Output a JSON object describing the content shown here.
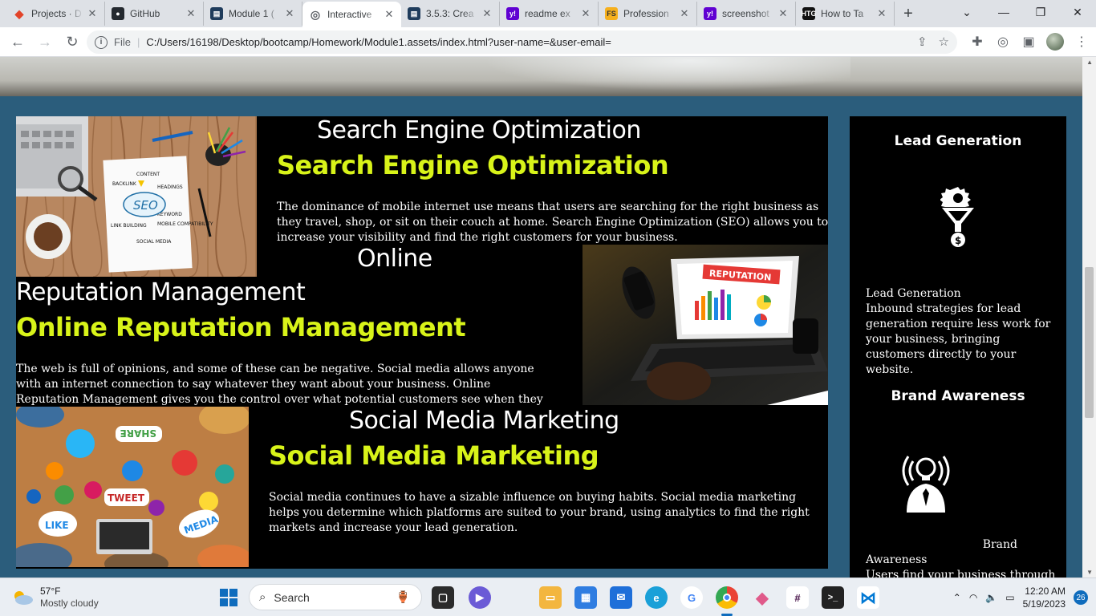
{
  "browser": {
    "tabs": [
      {
        "label": "Projects · D",
        "icon": "gitlab-icon",
        "color": "#e24329"
      },
      {
        "label": "GitHub",
        "icon": "github-icon",
        "color": "#24292f"
      },
      {
        "label": "Module 1 (",
        "icon": "canvas-icon",
        "color": "#1f3c5c"
      },
      {
        "label": "Interactive",
        "icon": "globe-icon",
        "color": "#5f6368",
        "active": true
      },
      {
        "label": "3.5.3: Crea",
        "icon": "canvas-icon",
        "color": "#1f3c5c"
      },
      {
        "label": "readme ex",
        "icon": "yahoo-icon",
        "color": "#6001d2"
      },
      {
        "label": "Profession",
        "icon": "fs-icon",
        "color": "#f6b01e"
      },
      {
        "label": "screenshot",
        "icon": "yahoo-icon",
        "color": "#6001d2"
      },
      {
        "label": "How to Ta",
        "icon": "htg-icon",
        "color": "#111111"
      }
    ],
    "new_tab": "+",
    "address": {
      "scheme": "File",
      "url": "C:/Users/16198/Desktop/bootcamp/Homework/Module1.assets/index.html?user-name=&user-email="
    }
  },
  "page": {
    "services": [
      {
        "title": "Search Engine Optimization",
        "subtitle": "Search Engine Optimization",
        "body": "The dominance of mobile internet use means that users are searching for the right business as they travel, shop, or sit on their couch at home. Search Engine Optimization (SEO) allows you to increase your visibility and find the right customers for your business."
      },
      {
        "title_line1": "Online",
        "title_line2": "Reputation Management",
        "subtitle": "Online Reputation Management",
        "body": "The web is full of opinions, and some of these can be negative. Social media allows anyone with an internet connection to say whatever they want about your business. Online Reputation Management gives you the control over what potential customers see when they search for your business."
      },
      {
        "title": "Social Media Marketing",
        "subtitle": "Social Media Marketing",
        "body": "Social media continues to have a sizable influence on buying habits. Social media marketing helps you determine which platforms are suited to your brand, using analytics to find the right markets and increase your lead generation."
      }
    ],
    "seo_image_labels": {
      "seo": "SEO",
      "content": "CONTENT",
      "backlink": "BACKLINK",
      "headings": "HEADINGS",
      "keyword": "KEYWORD",
      "link_building": "LINK BUILDING",
      "mobile": "MOBILE COMPATIBILITY",
      "social": "SOCIAL MEDIA"
    },
    "rep_image_label": "REPUTATION",
    "social_image_labels": {
      "share": "SHARE",
      "tweet": "TWEET",
      "like": "LIKE",
      "media": "MEDIA"
    },
    "benefits": [
      {
        "title": "Lead Generation",
        "label": "Lead Generation",
        "text": "Inbound strategies for lead generation require less work for your business, bringing customers directly to your website."
      },
      {
        "title": "Brand Awareness",
        "label_line1": "Brand",
        "label_line2": "Awareness",
        "text": "Users find your business through"
      }
    ]
  },
  "taskbar": {
    "weather_temp": "57°F",
    "weather_desc": "Mostly cloudy",
    "search_placeholder": "Search",
    "time": "12:20 AM",
    "date": "5/19/2023",
    "notifications": "26"
  },
  "colors": {
    "page_bg": "#2b5d7c",
    "accent_yellow": "#d8f319",
    "block_bg": "#000000"
  }
}
